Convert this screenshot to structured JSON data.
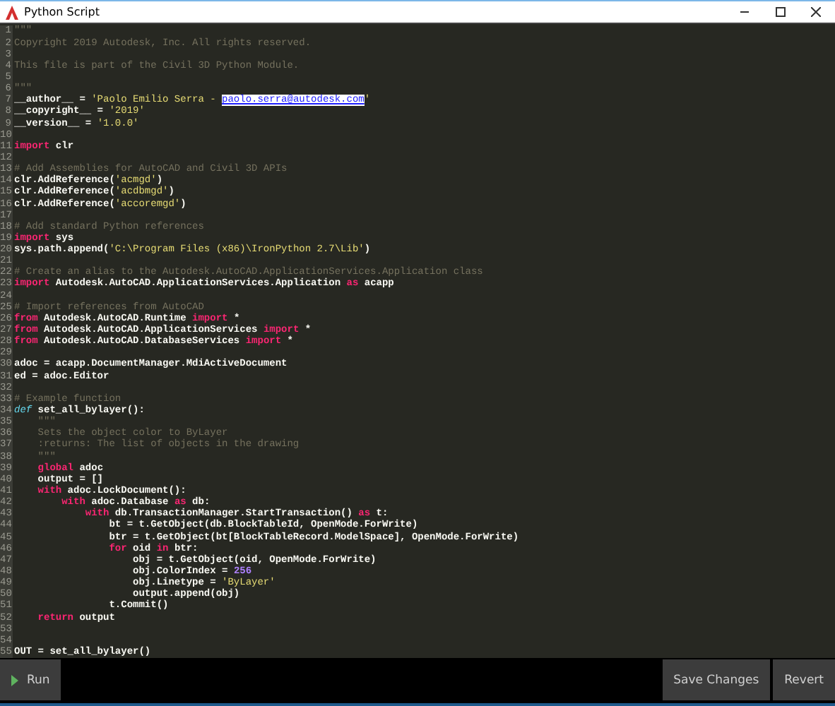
{
  "window": {
    "title": "Python Script"
  },
  "editor": {
    "lines": [
      {
        "number": "1",
        "tokens": [
          {
            "kind": "comment",
            "text": "\"\"\""
          }
        ]
      },
      {
        "number": "2",
        "tokens": [
          {
            "kind": "comment",
            "text": "Copyright 2019 Autodesk, Inc. All rights reserved."
          }
        ]
      },
      {
        "number": "3"
      },
      {
        "number": "4",
        "tokens": [
          {
            "kind": "comment",
            "text": "This file is part of the Civil 3D Python Module."
          }
        ]
      },
      {
        "number": "5"
      },
      {
        "number": "6",
        "tokens": [
          {
            "kind": "comment",
            "text": "\"\"\""
          }
        ]
      },
      {
        "number": "7",
        "tokens": [
          {
            "kind": "plain",
            "text": "__author__ = "
          },
          {
            "kind": "string",
            "text": "'Paolo Emilio Serra - "
          },
          {
            "kind": "link",
            "text": "paolo.serra@autodesk.com"
          },
          {
            "kind": "string",
            "text": "'"
          }
        ]
      },
      {
        "number": "8",
        "tokens": [
          {
            "kind": "plain",
            "text": "__copyright__ = "
          },
          {
            "kind": "string",
            "text": "'2019'"
          }
        ]
      },
      {
        "number": "9",
        "tokens": [
          {
            "kind": "plain",
            "text": "__version__ = "
          },
          {
            "kind": "string",
            "text": "'1.0.0'"
          }
        ]
      },
      {
        "number": "10"
      },
      {
        "number": "11",
        "tokens": [
          {
            "kind": "keyword",
            "text": "import"
          },
          {
            "kind": "plain",
            "text": " clr"
          }
        ]
      },
      {
        "number": "12"
      },
      {
        "number": "13",
        "tokens": [
          {
            "kind": "comment",
            "text": "# Add Assemblies for AutoCAD and Civil 3D APIs"
          }
        ]
      },
      {
        "number": "14",
        "tokens": [
          {
            "kind": "plain",
            "text": "clr.AddReference("
          },
          {
            "kind": "string",
            "text": "'acmgd'"
          },
          {
            "kind": "plain",
            "text": ")"
          }
        ]
      },
      {
        "number": "15",
        "tokens": [
          {
            "kind": "plain",
            "text": "clr.AddReference("
          },
          {
            "kind": "string",
            "text": "'acdbmgd'"
          },
          {
            "kind": "plain",
            "text": ")"
          }
        ]
      },
      {
        "number": "16",
        "tokens": [
          {
            "kind": "plain",
            "text": "clr.AddReference("
          },
          {
            "kind": "string",
            "text": "'accoremgd'"
          },
          {
            "kind": "plain",
            "text": ")"
          }
        ]
      },
      {
        "number": "17"
      },
      {
        "number": "18",
        "tokens": [
          {
            "kind": "comment",
            "text": "# Add standard Python references"
          }
        ]
      },
      {
        "number": "19",
        "tokens": [
          {
            "kind": "keyword",
            "text": "import"
          },
          {
            "kind": "plain",
            "text": " sys"
          }
        ]
      },
      {
        "number": "20",
        "tokens": [
          {
            "kind": "plain",
            "text": "sys.path.append("
          },
          {
            "kind": "string",
            "text": "'C:\\Program Files (x86)\\IronPython 2.7\\Lib'"
          },
          {
            "kind": "plain",
            "text": ")"
          }
        ]
      },
      {
        "number": "21"
      },
      {
        "number": "22",
        "tokens": [
          {
            "kind": "comment",
            "text": "# Create an alias to the Autodesk.AutoCAD.ApplicationServices.Application class"
          }
        ]
      },
      {
        "number": "23",
        "tokens": [
          {
            "kind": "keyword",
            "text": "import"
          },
          {
            "kind": "plain",
            "text": " Autodesk.AutoCAD.ApplicationServices.Application "
          },
          {
            "kind": "keyword",
            "text": "as"
          },
          {
            "kind": "plain",
            "text": " acapp"
          }
        ]
      },
      {
        "number": "24"
      },
      {
        "number": "25",
        "tokens": [
          {
            "kind": "comment",
            "text": "# Import references from AutoCAD"
          }
        ]
      },
      {
        "number": "26",
        "tokens": [
          {
            "kind": "keyword",
            "text": "from"
          },
          {
            "kind": "plain",
            "text": " Autodesk.AutoCAD.Runtime "
          },
          {
            "kind": "keyword",
            "text": "import"
          },
          {
            "kind": "plain",
            "text": " *"
          }
        ]
      },
      {
        "number": "27",
        "tokens": [
          {
            "kind": "keyword",
            "text": "from"
          },
          {
            "kind": "plain",
            "text": " Autodesk.AutoCAD.ApplicationServices "
          },
          {
            "kind": "keyword",
            "text": "import"
          },
          {
            "kind": "plain",
            "text": " *"
          }
        ]
      },
      {
        "number": "28",
        "tokens": [
          {
            "kind": "keyword",
            "text": "from"
          },
          {
            "kind": "plain",
            "text": " Autodesk.AutoCAD.DatabaseServices "
          },
          {
            "kind": "keyword",
            "text": "import"
          },
          {
            "kind": "plain",
            "text": " *"
          }
        ]
      },
      {
        "number": "29"
      },
      {
        "number": "30",
        "tokens": [
          {
            "kind": "plain",
            "text": "adoc = acapp.DocumentManager.MdiActiveDocument"
          }
        ]
      },
      {
        "number": "31",
        "tokens": [
          {
            "kind": "plain",
            "text": "ed = adoc.Editor"
          }
        ]
      },
      {
        "number": "32"
      },
      {
        "number": "33",
        "tokens": [
          {
            "kind": "comment",
            "text": "# Example function"
          }
        ]
      },
      {
        "number": "34",
        "tokens": [
          {
            "kind": "def",
            "text": "def"
          },
          {
            "kind": "plain",
            "text": " set_all_bylayer():"
          }
        ]
      },
      {
        "number": "35",
        "tokens": [
          {
            "kind": "comment",
            "text": "    \"\"\""
          }
        ]
      },
      {
        "number": "36",
        "tokens": [
          {
            "kind": "comment",
            "text": "    Sets the object color to ByLayer"
          }
        ]
      },
      {
        "number": "37",
        "tokens": [
          {
            "kind": "comment",
            "text": "    :returns: The list of objects in the drawing"
          }
        ]
      },
      {
        "number": "38",
        "tokens": [
          {
            "kind": "comment",
            "text": "    \"\"\""
          }
        ]
      },
      {
        "number": "39",
        "tokens": [
          {
            "kind": "keyword",
            "text": "    global"
          },
          {
            "kind": "plain",
            "text": " adoc"
          }
        ]
      },
      {
        "number": "40",
        "tokens": [
          {
            "kind": "plain",
            "text": "    output = []"
          }
        ]
      },
      {
        "number": "41",
        "tokens": [
          {
            "kind": "keyword",
            "text": "    with"
          },
          {
            "kind": "plain",
            "text": " adoc.LockDocument():"
          }
        ]
      },
      {
        "number": "42",
        "tokens": [
          {
            "kind": "keyword",
            "text": "        with"
          },
          {
            "kind": "plain",
            "text": " adoc.Database "
          },
          {
            "kind": "keyword",
            "text": "as"
          },
          {
            "kind": "plain",
            "text": " db:"
          }
        ]
      },
      {
        "number": "43",
        "tokens": [
          {
            "kind": "keyword",
            "text": "            with"
          },
          {
            "kind": "plain",
            "text": " db.TransactionManager.StartTransaction() "
          },
          {
            "kind": "keyword",
            "text": "as"
          },
          {
            "kind": "plain",
            "text": " t:"
          }
        ]
      },
      {
        "number": "44",
        "tokens": [
          {
            "kind": "plain",
            "text": "                bt = t.GetObject(db.BlockTableId, OpenMode.ForWrite)"
          }
        ]
      },
      {
        "number": "45",
        "tokens": [
          {
            "kind": "plain",
            "text": "                btr = t.GetObject(bt[BlockTableRecord.ModelSpace], OpenMode.ForWrite)"
          }
        ]
      },
      {
        "number": "46",
        "tokens": [
          {
            "kind": "keyword",
            "text": "                for"
          },
          {
            "kind": "plain",
            "text": " oid "
          },
          {
            "kind": "keyword",
            "text": "in"
          },
          {
            "kind": "plain",
            "text": " btr:"
          }
        ]
      },
      {
        "number": "47",
        "tokens": [
          {
            "kind": "plain",
            "text": "                    obj = t.GetObject(oid, OpenMode.ForWrite)"
          }
        ]
      },
      {
        "number": "48",
        "tokens": [
          {
            "kind": "plain",
            "text": "                    obj.ColorIndex = "
          },
          {
            "kind": "number",
            "text": "256"
          }
        ]
      },
      {
        "number": "49",
        "tokens": [
          {
            "kind": "plain",
            "text": "                    obj.Linetype = "
          },
          {
            "kind": "string",
            "text": "'ByLayer'"
          }
        ]
      },
      {
        "number": "50",
        "tokens": [
          {
            "kind": "plain",
            "text": "                    output.append(obj)"
          }
        ]
      },
      {
        "number": "51",
        "tokens": [
          {
            "kind": "plain",
            "text": "                t.Commit()"
          }
        ]
      },
      {
        "number": "52",
        "tokens": [
          {
            "kind": "keyword",
            "text": "    return"
          },
          {
            "kind": "plain",
            "text": " output"
          }
        ]
      },
      {
        "number": "53"
      },
      {
        "number": "54"
      },
      {
        "number": "55",
        "tokens": [
          {
            "kind": "plain",
            "text": "OUT = set_all_bylayer()"
          }
        ]
      }
    ]
  },
  "buttons": {
    "run": "Run",
    "save": "Save Changes",
    "revert": "Revert"
  }
}
